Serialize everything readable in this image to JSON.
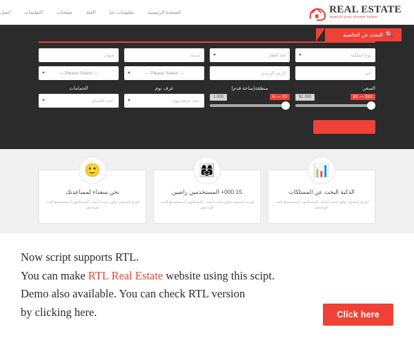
{
  "brand": {
    "logo_title": "REAL ESTATE",
    "logo_tagline": "search your dream home",
    "logo_icon": "house-logo-icon",
    "accent_color": "#ef4136",
    "dark_color": "#2b2b2b",
    "light_gray": "#f0f0f0"
  },
  "nav": {
    "items": [
      {
        "label": "الصفحة الرئيسية",
        "name": "nav-item-home"
      },
      {
        "label": "معلومات عنا",
        "name": "nav-item-about"
      },
      {
        "label": "الفئة",
        "name": "nav-item-category"
      },
      {
        "label": "صفحات",
        "name": "nav-item-pages"
      },
      {
        "label": "التعليمات",
        "name": "nav-item-faq"
      },
      {
        "label": "اتصل",
        "name": "nav-item-contact"
      }
    ]
  },
  "search_panel": {
    "tab_label": "البحث عن الخاصية",
    "tab_icon": "search-icon",
    "row1": [
      {
        "placeholder": "نوع الملكية",
        "type": "select",
        "name": "property-type-select"
      },
      {
        "placeholder": "فئة العقار",
        "type": "select",
        "name": "property-category-select"
      },
      {
        "placeholder": "مدينة",
        "type": "text",
        "name": "city-input"
      },
      {
        "placeholder": "عنوان",
        "type": "text",
        "name": "address-input"
      }
    ],
    "row2": [
      {
        "placeholder": "حي",
        "type": "text",
        "name": "neighborhood-input"
      },
      {
        "placeholder": "الرمز البريدي",
        "type": "text",
        "name": "postal-code-input"
      },
      {
        "placeholder": "— Please Select —",
        "type": "select",
        "name": "select-option-one"
      },
      {
        "placeholder": "— Please Select —",
        "type": "select",
        "name": "select-option-two"
      }
    ],
    "labels": {
      "price": "السعر:",
      "area": "منطقة(ساحة قدم)",
      "bedrooms": "غرف نوم",
      "bathrooms": "الحمامات"
    },
    "price_slider": {
      "value_label": "$1 — $10",
      "max_label": "$1 000",
      "min": 1,
      "max": 1000
    },
    "area_slider": {
      "value_label": "0 — 10",
      "max_label": "1 000",
      "min": 0,
      "max": 1000
    },
    "bedrooms_select": "-حدد غرفة نوم-",
    "bathrooms_select": "-حدد الحمام-",
    "submit_label": ""
  },
  "features": [
    {
      "icon": "chart-search-icon",
      "glyph": "📊",
      "title": "الذكية البحث عن الممتلكات",
      "body": "لوريم إيبسوم دولور سيت أميت، كونسكتيور أديبيسسينغ إليت. كورابيتور"
    },
    {
      "icon": "users-group-icon",
      "glyph": "👩‍👩‍👧",
      "title": "15 000+ المستخدمين راضين",
      "body": "لوريم إيبسوم دولور سيت أميت، كونسكتيور أديبيسسينغ إليت. كورابيتور"
    },
    {
      "icon": "smiley-face-icon",
      "glyph": "🙂",
      "title": "نحن سعداء لمساعدتك",
      "body": "لوريم إيبسوم دولور سيت أميت، كونسكتيور أديبيسسينغ إليت. كورابيتور"
    }
  ],
  "promo": {
    "line1": "Now script supports RTL.",
    "line2_a": "You can make ",
    "line2_highlight": "RTL Real Estate",
    "line2_b": " website using this scipt.",
    "line3": "Demo also available. You can check RTL version",
    "line4": "by clicking here.",
    "button_label": "Click here"
  }
}
